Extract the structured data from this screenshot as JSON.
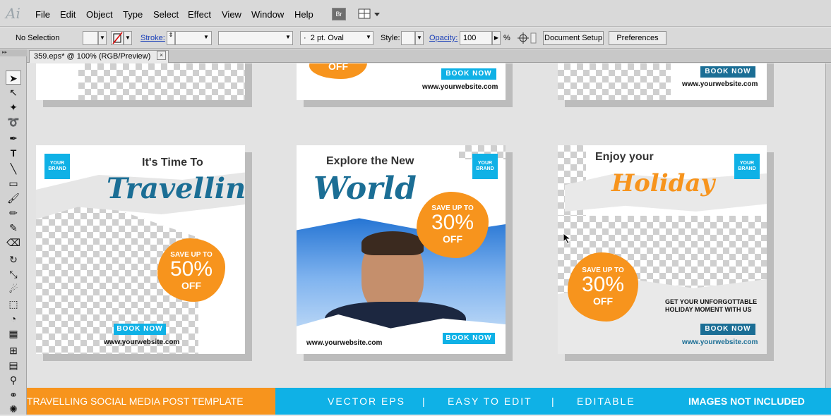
{
  "app": {
    "logo": "Ai"
  },
  "menu": [
    "File",
    "Edit",
    "Object",
    "Type",
    "Select",
    "Effect",
    "View",
    "Window",
    "Help"
  ],
  "bridge_label": "Br",
  "control": {
    "selection": "No Selection",
    "stroke_label": "Stroke:",
    "brush": "2 pt. Oval",
    "style_label": "Style:",
    "opacity_label": "Opacity:",
    "opacity_value": "100",
    "percent": "%",
    "document_setup": "Document Setup",
    "preferences": "Preferences"
  },
  "document_tab": {
    "title": "359.eps* @ 100% (RGB/Preview)",
    "close": "×"
  },
  "tools": [
    "selection-tool",
    "direct-selection-tool",
    "magic-wand-tool",
    "lasso-tool",
    "pen-tool",
    "type-tool",
    "line-tool",
    "rectangle-tool",
    "paintbrush-tool",
    "pencil-tool",
    "blob-brush-tool",
    "eraser-tool",
    "rotate-tool",
    "scale-tool",
    "warp-tool",
    "free-transform-tool",
    "shape-builder-tool",
    "perspective-tool",
    "mesh-tool",
    "gradient-tool",
    "eyedropper-tool",
    "blend-tool",
    "symbol-sprayer-tool"
  ],
  "cards": {
    "top_website": "www.yourwebsite.com",
    "top_book": "BOOK NOW",
    "top_off": "OFF",
    "brand_line1": "YOUR",
    "brand_line2": "BRAND",
    "brand_dots": "• • •",
    "c1": {
      "headline": "It's Time To",
      "script": "Travelling",
      "save": "SAVE UP TO",
      "percent": "50%",
      "off": "OFF",
      "book": "BOOK NOW",
      "website": "www.yourwebsite.com"
    },
    "c2": {
      "headline": "Explore the New",
      "script": "World",
      "save": "SAVE UP TO",
      "percent": "30%",
      "off": "OFF",
      "book": "BOOK NOW",
      "website": "www.yourwebsite.com"
    },
    "c3": {
      "headline": "Enjoy your",
      "script": "Holiday",
      "save": "SAVE UP TO",
      "percent": "30%",
      "off": "OFF",
      "tagline1": "GET YOUR UNFORGOTTABLE",
      "tagline2": "HOLIDAY MOMENT WITH US",
      "book": "BOOK NOW",
      "website": "www.yourwebsite.com"
    }
  },
  "footer": {
    "left": "TRAVELLING SOCIAL MEDIA POST TEMPLATE",
    "vector": "VECTOR EPS",
    "easy": "EASY TO EDIT",
    "editable": "EDITABLE",
    "images": "IMAGES NOT INCLUDED",
    "sep": "|"
  },
  "colors": {
    "orange": "#f7941d",
    "cyan": "#0fb1e6",
    "dark_teal": "#1b6e95"
  }
}
